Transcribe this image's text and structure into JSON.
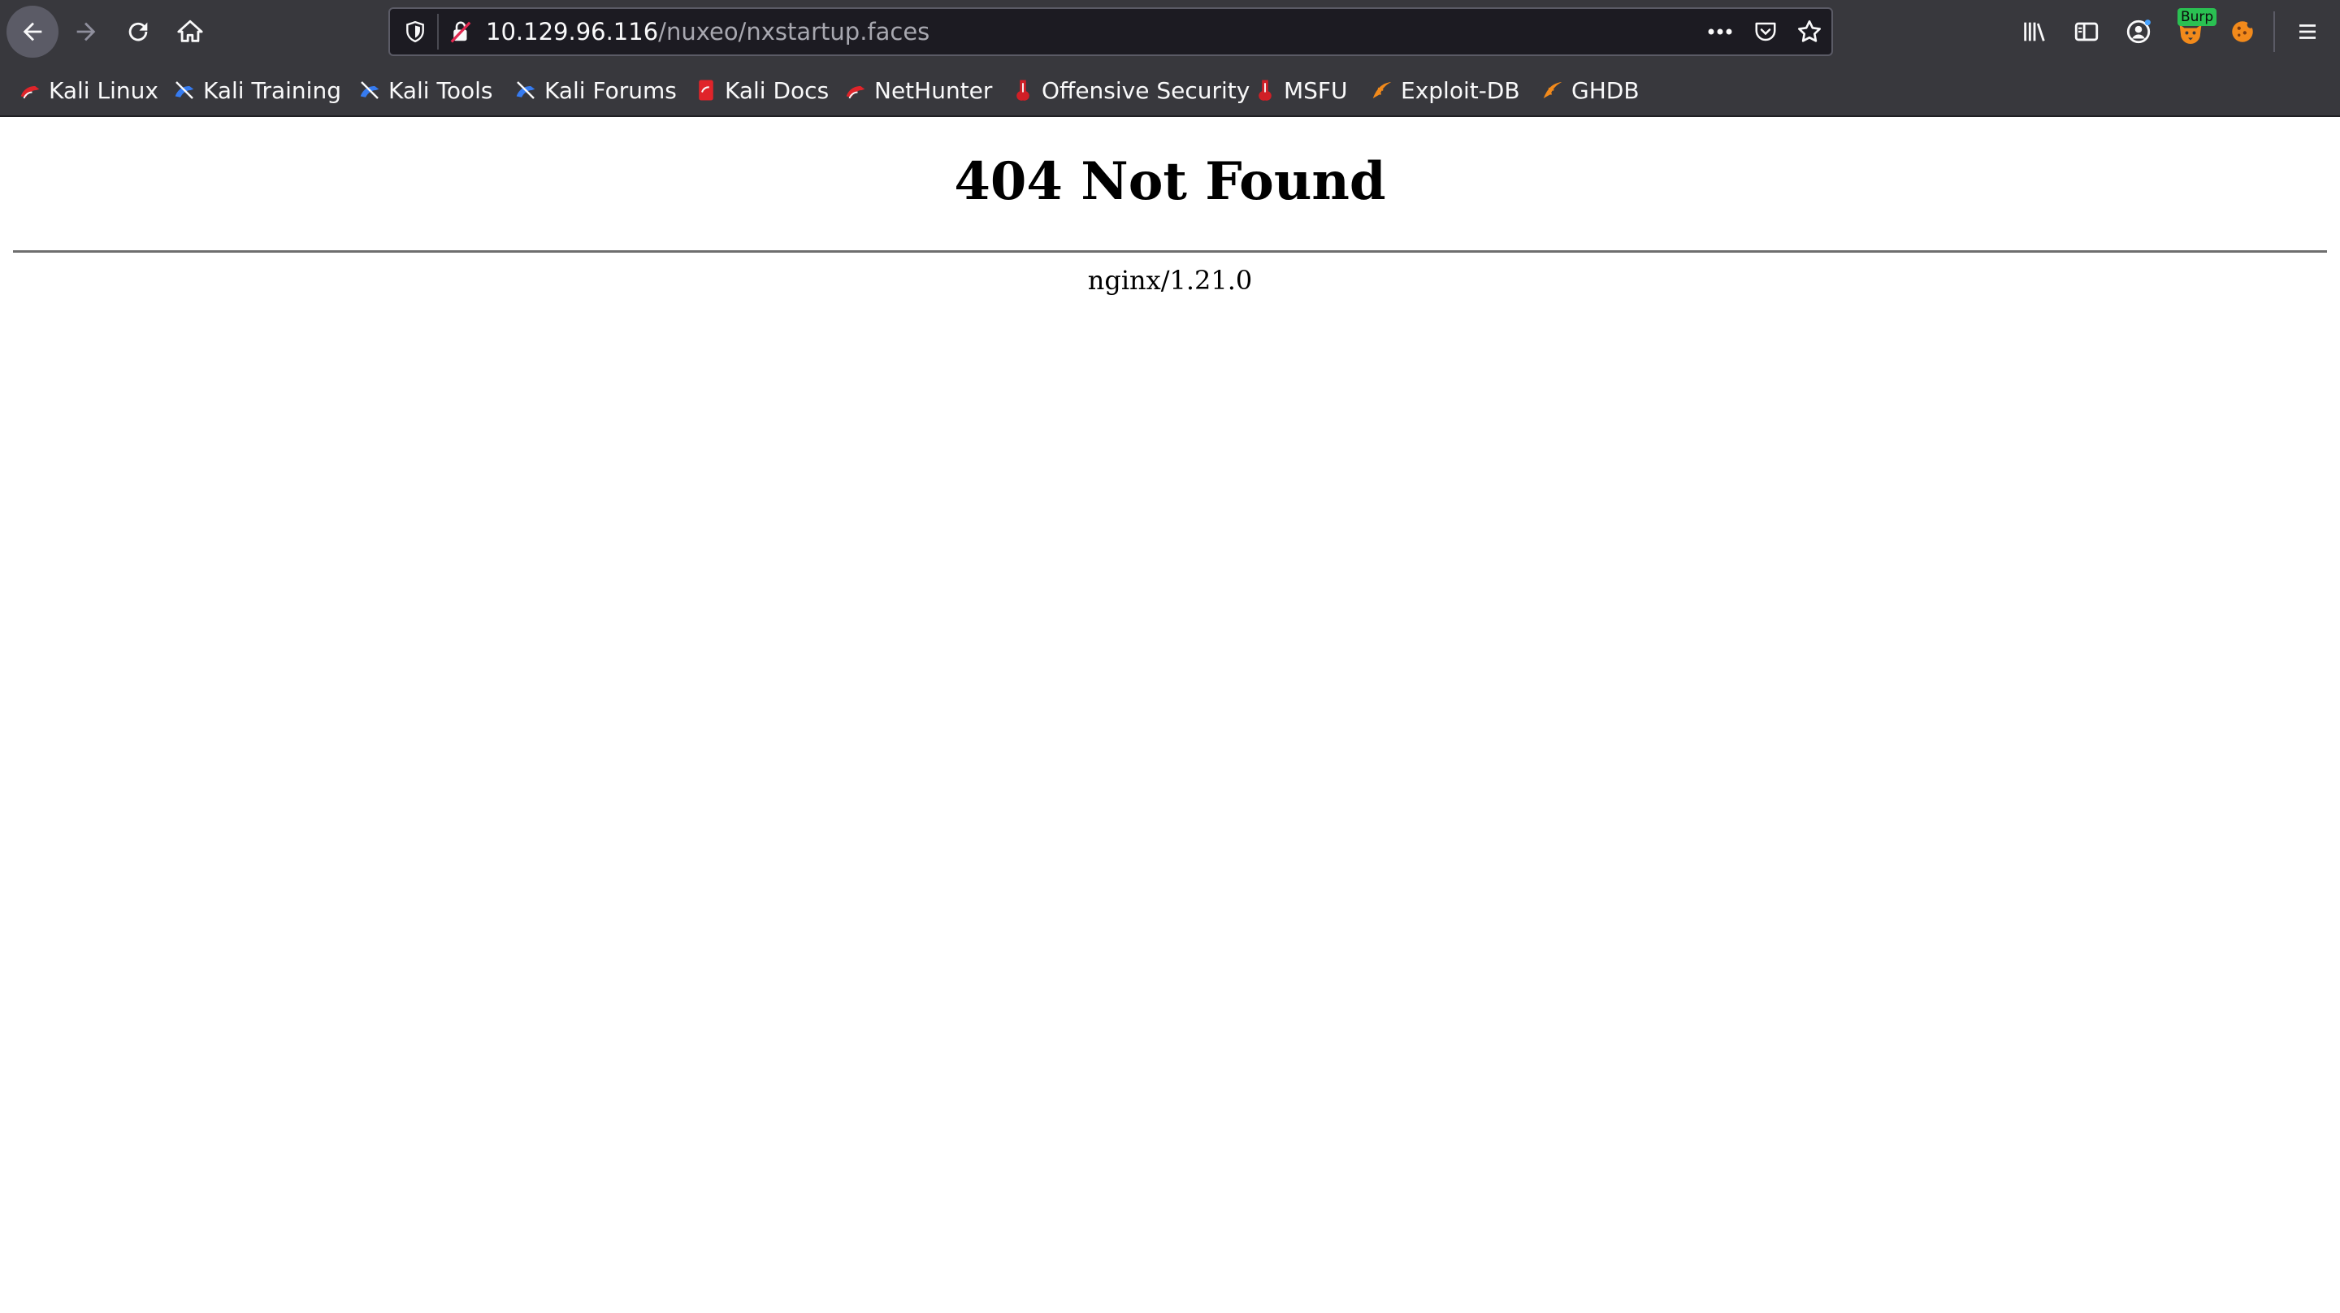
{
  "browser": {
    "url_host": "10.129.96.116",
    "url_path": "/nuxeo/nxstartup.faces",
    "burp_badge": "Burp"
  },
  "icons": {
    "back": "back-arrow-icon",
    "forward": "forward-arrow-icon",
    "reload": "reload-icon",
    "home": "home-icon",
    "shield": "tracking-protection-shield-icon",
    "insecure": "insecure-connection-icon",
    "page_actions": "more-dots-icon",
    "pocket": "pocket-icon",
    "bookmark_star": "star-icon",
    "library": "library-icon",
    "sidebar": "sidebar-icon",
    "account": "account-icon",
    "foxyproxy": "foxyproxy-icon",
    "cookie": "cookie-extension-icon",
    "menu": "hamburger-menu-icon"
  },
  "bookmarks": [
    {
      "label": "Kali Linux",
      "icon": "kali-dragon-icon"
    },
    {
      "label": "Kali Training",
      "icon": "kali-training-icon"
    },
    {
      "label": "Kali Tools",
      "icon": "kali-tools-icon"
    },
    {
      "label": "Kali Forums",
      "icon": "kali-forums-icon"
    },
    {
      "label": "Kali Docs",
      "icon": "kali-docs-icon"
    },
    {
      "label": "NetHunter",
      "icon": "nethunter-icon"
    },
    {
      "label": "Offensive Security",
      "icon": "offsec-icon"
    },
    {
      "label": "MSFU",
      "icon": "msfu-icon"
    },
    {
      "label": "Exploit-DB",
      "icon": "exploitdb-icon"
    },
    {
      "label": "GHDB",
      "icon": "ghdb-icon"
    }
  ],
  "page": {
    "heading": "404 Not Found",
    "server": "nginx/1.21.0"
  },
  "colors": {
    "toolbar_bg": "#38383d",
    "urlbar_bg": "#1c1b22",
    "kali_red": "#e0242a",
    "kali_blue": "#367bf0",
    "offsec_red": "#d01f26",
    "exploit_orange": "#f28a1b"
  }
}
